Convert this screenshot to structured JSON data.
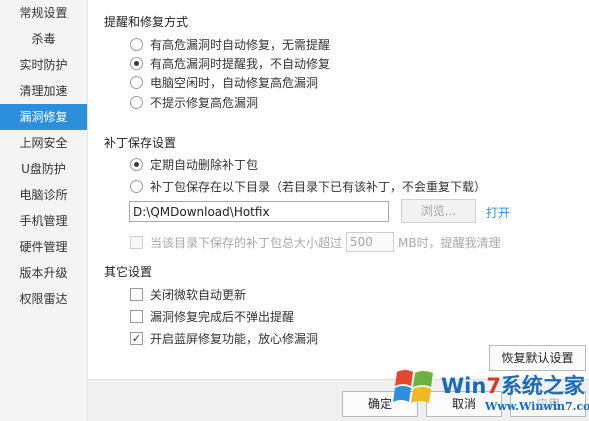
{
  "sidebar": {
    "items": [
      {
        "label": "常规设置"
      },
      {
        "label": "杀毒"
      },
      {
        "label": "实时防护"
      },
      {
        "label": "清理加速"
      },
      {
        "label": "漏洞修复",
        "active": true
      },
      {
        "label": "上网安全"
      },
      {
        "label": "U盘防护"
      },
      {
        "label": "电脑诊所"
      },
      {
        "label": "手机管理"
      },
      {
        "label": "硬件管理"
      },
      {
        "label": "版本升级"
      },
      {
        "label": "权限雷达"
      }
    ]
  },
  "repair_mode": {
    "title": "提醒和修复方式",
    "options": [
      {
        "label": "有高危漏洞时自动修复，无需提醒",
        "checked": false
      },
      {
        "label": "有高危漏洞时提醒我，不自动修复",
        "checked": true
      },
      {
        "label": "电脑空闲时，自动修复高危漏洞",
        "checked": false
      },
      {
        "label": "不提示修复高危漏洞",
        "checked": false
      }
    ]
  },
  "patch_save": {
    "title": "补丁保存设置",
    "options": [
      {
        "label": "定期自动删除补丁包",
        "checked": true
      },
      {
        "label": "补丁包保存在以下目录（若目录下已有该补丁，不会重复下载）",
        "checked": false
      }
    ],
    "path_value": "D:\\QMDownload\\Hotfix",
    "browse_label": "浏览...",
    "open_label": "打开",
    "size_limit": {
      "prefix": "当该目录下保存的补丁包总大小超过",
      "value": "500",
      "suffix": "MB时，提醒我清理",
      "checked": false,
      "enabled": false
    }
  },
  "other": {
    "title": "其它设置",
    "options": [
      {
        "label": "关闭微软自动更新",
        "checked": false
      },
      {
        "label": "漏洞修复完成后不弹出提醒",
        "checked": false
      },
      {
        "label": "开启蓝屏修复功能，放心修漏洞",
        "checked": true
      }
    ]
  },
  "buttons": {
    "restore": "恢复默认设置",
    "ok": "确定",
    "cancel": "取消",
    "apply": "应用"
  },
  "watermark": {
    "line1_a": "Win",
    "line1_b": "7",
    "line1_c": "系统之家",
    "line2": "Www.Winwin7.com"
  },
  "colors": {
    "accent": "#2b8fdc",
    "sidebar_bg": "#f4f4f4"
  }
}
